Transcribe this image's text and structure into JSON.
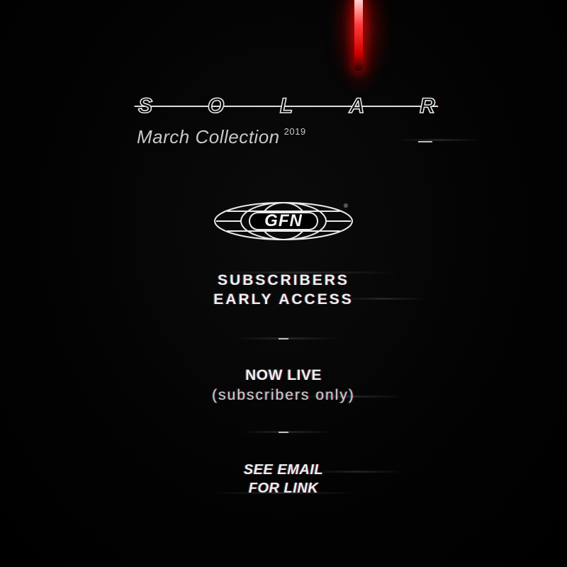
{
  "title": {
    "letters": [
      "S",
      "O",
      "L",
      "A",
      "R"
    ]
  },
  "subtitle": {
    "text": "March Collection",
    "year": "2019"
  },
  "logo": {
    "text": "GFN",
    "registered": "®"
  },
  "access": {
    "line1": "SUBSCRIBERS",
    "line2": "EARLY ACCESS"
  },
  "status": {
    "line1": "NOW LIVE",
    "line2": "(subscribers only)"
  },
  "cta": {
    "line1": "SEE EMAIL",
    "line2": "FOR LINK"
  },
  "colors": {
    "background": "#000000",
    "text": "#eeeeee",
    "accent": "#ff2a2a"
  }
}
